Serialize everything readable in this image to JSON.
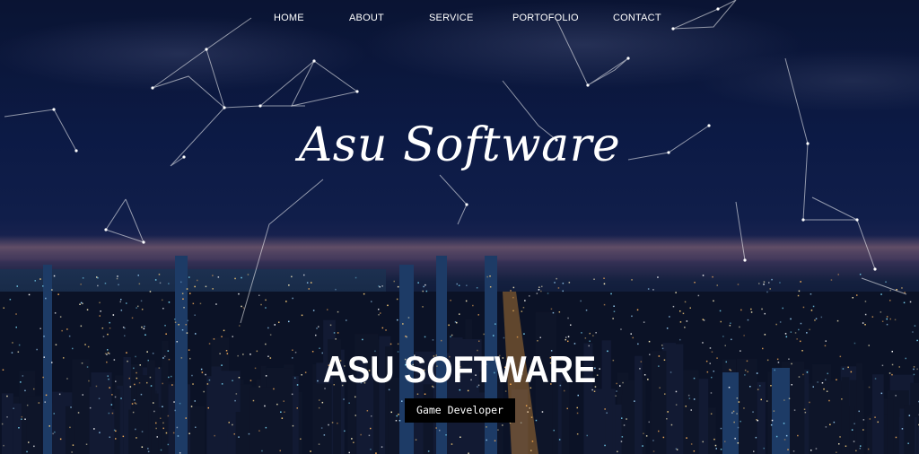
{
  "nav": {
    "items": [
      "HOME",
      "ABOUT",
      "SERVICE",
      "PORTOFOLIO",
      "CONTACT"
    ]
  },
  "hero": {
    "brand": "Asu Software",
    "headline": "ASU SOFTWARE",
    "tagline": "Game Developer"
  },
  "colors": {
    "sky": "#0c1a45",
    "text": "#ffffff",
    "tag_background": "#000000"
  }
}
